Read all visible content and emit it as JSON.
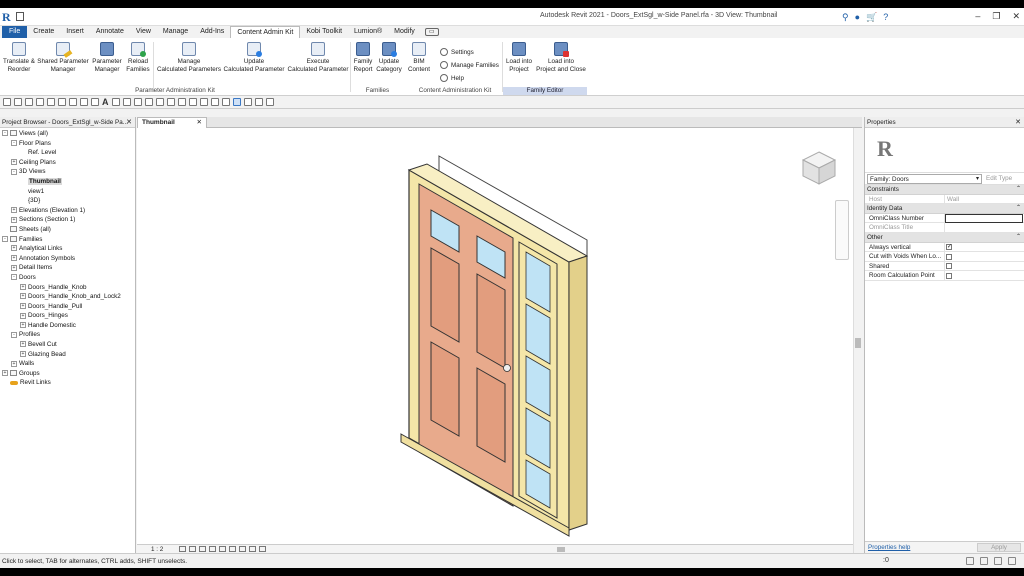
{
  "titlebar": {
    "title": "Autodesk Revit 2021 - Doors_ExtSgl_w-Side Panel.rfa - 3D View: Thumbnail",
    "logo": "R"
  },
  "tabs": [
    "File",
    "Create",
    "Insert",
    "Annotate",
    "View",
    "Manage",
    "Add-Ins",
    "Content Admin Kit",
    "Kobi Toolkit",
    "Lumion®",
    "Modify"
  ],
  "ribbon": {
    "translate": "Translate &\nReorder",
    "shared_param_mgr": "Shared Parameter\nManager",
    "param_mgr": "Parameter\nManager",
    "reload_families": "Reload\nFamilies",
    "manage_calc": "Manage\nCalculated Parameters",
    "update_calc": "Update\nCalculated Parameter",
    "execute_calc": "Execute\nCalculated Parameter",
    "family_report": "Family\nReport",
    "update_category": "Update\nCategory",
    "bim_content": "BIM\nContent",
    "settings": "Settings",
    "manage_families": "Manage Families",
    "help": "Help",
    "load_into_project": "Load into\nProject",
    "load_close": "Load into\nProject and Close",
    "panel_param_admin": "Parameter Administration Kit",
    "panel_families": "Families",
    "panel_content_admin": "Content Administration Kit",
    "panel_family_editor": "Family Editor"
  },
  "project_browser": {
    "title": "Project Browser - Doors_ExtSgl_w-Side Pa...",
    "items": [
      {
        "label": "Views (all)",
        "indent": 0,
        "toggle": "-",
        "icon": true
      },
      {
        "label": "Floor Plans",
        "indent": 1,
        "toggle": "-"
      },
      {
        "label": "Ref. Level",
        "indent": 2,
        "toggle": ""
      },
      {
        "label": "Ceiling Plans",
        "indent": 1,
        "toggle": "+"
      },
      {
        "label": "3D Views",
        "indent": 1,
        "toggle": "-"
      },
      {
        "label": "Thumbnail",
        "indent": 2,
        "toggle": "",
        "selected": true
      },
      {
        "label": "view1",
        "indent": 2,
        "toggle": ""
      },
      {
        "label": "{3D}",
        "indent": 2,
        "toggle": ""
      },
      {
        "label": "Elevations (Elevation 1)",
        "indent": 1,
        "toggle": "+"
      },
      {
        "label": "Sections (Section 1)",
        "indent": 1,
        "toggle": "+"
      },
      {
        "label": "Sheets (all)",
        "indent": 0,
        "toggle": "",
        "icon": true
      },
      {
        "label": "Families",
        "indent": 0,
        "toggle": "-",
        "icon": true
      },
      {
        "label": "Analytical Links",
        "indent": 1,
        "toggle": "+"
      },
      {
        "label": "Annotation Symbols",
        "indent": 1,
        "toggle": "+"
      },
      {
        "label": "Detail Items",
        "indent": 1,
        "toggle": "+"
      },
      {
        "label": "Doors",
        "indent": 1,
        "toggle": "-"
      },
      {
        "label": "Doors_Handle_Knob",
        "indent": 2,
        "toggle": "+"
      },
      {
        "label": "Doors_Handle_Knob_and_Lock2",
        "indent": 2,
        "toggle": "+"
      },
      {
        "label": "Doors_Handle_Pull",
        "indent": 2,
        "toggle": "+"
      },
      {
        "label": "Doors_Hinges",
        "indent": 2,
        "toggle": "+"
      },
      {
        "label": "Handle Domestic",
        "indent": 2,
        "toggle": "+"
      },
      {
        "label": "Profiles",
        "indent": 1,
        "toggle": "-"
      },
      {
        "label": "Bevell Cut",
        "indent": 2,
        "toggle": "+"
      },
      {
        "label": "Glazing Bead",
        "indent": 2,
        "toggle": "+"
      },
      {
        "label": "Walls",
        "indent": 1,
        "toggle": "+"
      },
      {
        "label": "Groups",
        "indent": 0,
        "toggle": "+",
        "icon": true
      },
      {
        "label": "Revit Links",
        "indent": 0,
        "toggle": "",
        "link": true
      }
    ]
  },
  "view": {
    "tab_label": "Thumbnail",
    "scale": "1 : 2"
  },
  "properties": {
    "title": "Properties",
    "family": "Family: Doors",
    "edit_type": "Edit Type",
    "sections": [
      {
        "name": "Constraints",
        "rows": [
          {
            "name": "Host",
            "value": "Wall",
            "dim": true
          }
        ]
      },
      {
        "name": "Identity Data",
        "rows": [
          {
            "name": "OmniClass Number",
            "value": "",
            "input": true
          },
          {
            "name": "OmniClass Title",
            "value": "",
            "dim": true
          }
        ]
      },
      {
        "name": "Other",
        "rows": [
          {
            "name": "Always vertical",
            "check": true,
            "checked": true
          },
          {
            "name": "Cut with Voids When Lo...",
            "check": true,
            "checked": false
          },
          {
            "name": "Shared",
            "check": true,
            "checked": false
          },
          {
            "name": "Room Calculation Point",
            "check": true,
            "checked": false
          }
        ]
      }
    ],
    "help_link": "Properties help",
    "apply": "Apply"
  },
  "statusbar": {
    "text": "Click to select, TAB for alternates, CTRL adds, SHIFT unselects.",
    "filter": ":0"
  },
  "colors": {
    "accent": "#1f5fa8",
    "door_leaf": "#e7a98a",
    "frame": "#f0e0a0",
    "glass": "#bfe3f5"
  }
}
